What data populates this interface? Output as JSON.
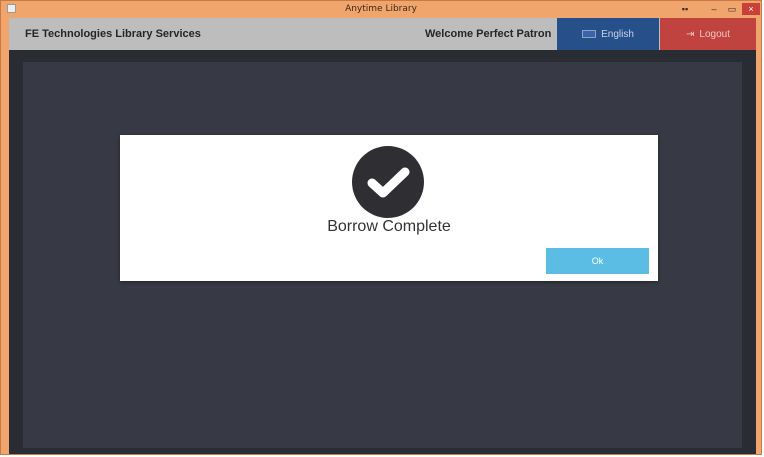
{
  "window": {
    "title": "Anytime Library",
    "controls": {
      "restore": "▪▪",
      "minimize": "–",
      "maximize": "▭",
      "close": "×"
    }
  },
  "header": {
    "brand": "FE Technologies Library Services",
    "welcome": "Welcome Perfect Patron",
    "language_label": "English",
    "logout_label": "Logout"
  },
  "modal": {
    "message": "Borrow Complete",
    "ok_label": "Ok",
    "icon": "checkmark-circle-icon"
  },
  "colors": {
    "titlebar": "#f0a56c",
    "header": "#bdbdbd",
    "language_button": "#26508a",
    "logout_button": "#c0433f",
    "content": "#373a44",
    "ok_button": "#5bbde3"
  }
}
